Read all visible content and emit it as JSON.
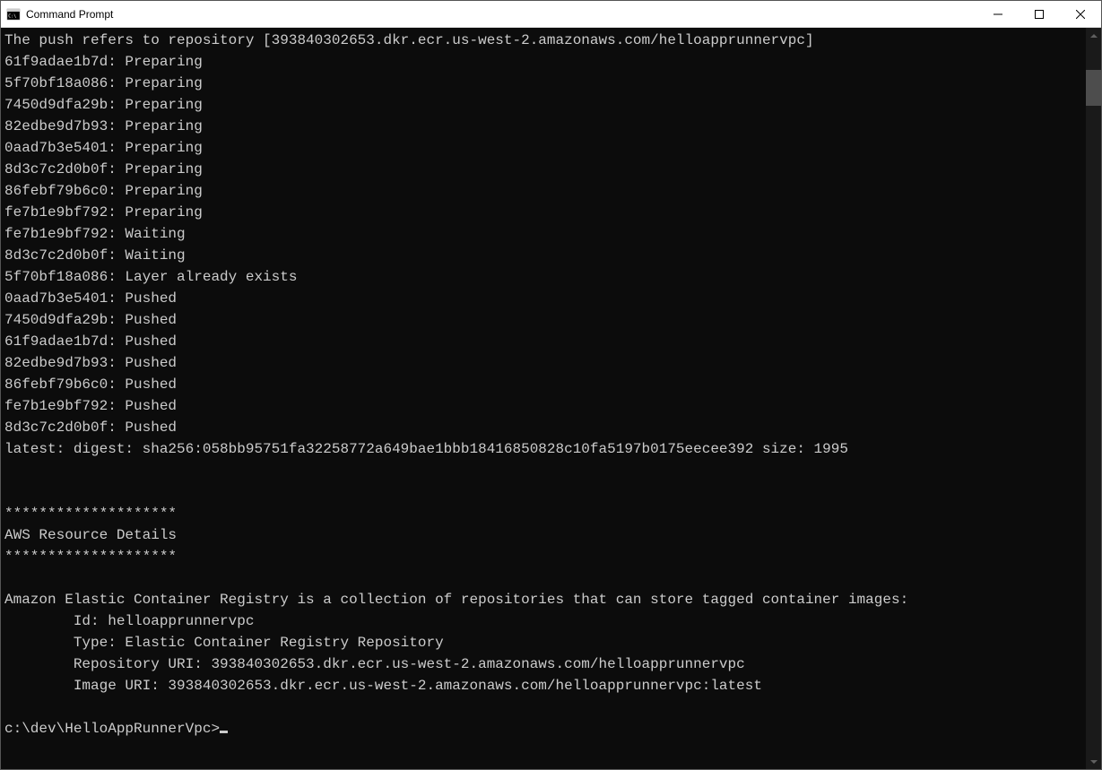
{
  "window": {
    "title": "Command Prompt"
  },
  "terminal": {
    "lines": [
      "The push refers to repository [393840302653.dkr.ecr.us-west-2.amazonaws.com/helloapprunnervpc]",
      "61f9adae1b7d: Preparing",
      "5f70bf18a086: Preparing",
      "7450d9dfa29b: Preparing",
      "82edbe9d7b93: Preparing",
      "0aad7b3e5401: Preparing",
      "8d3c7c2d0b0f: Preparing",
      "86febf79b6c0: Preparing",
      "fe7b1e9bf792: Preparing",
      "fe7b1e9bf792: Waiting",
      "8d3c7c2d0b0f: Waiting",
      "5f70bf18a086: Layer already exists",
      "0aad7b3e5401: Pushed",
      "7450d9dfa29b: Pushed",
      "61f9adae1b7d: Pushed",
      "82edbe9d7b93: Pushed",
      "86febf79b6c0: Pushed",
      "fe7b1e9bf792: Pushed",
      "8d3c7c2d0b0f: Pushed",
      "latest: digest: sha256:058bb95751fa32258772a649bae1bbb18416850828c10fa5197b0175eecee392 size: 1995",
      "",
      "",
      "********************",
      "AWS Resource Details",
      "********************",
      "",
      "Amazon Elastic Container Registry is a collection of repositories that can store tagged container images:",
      "        Id: helloapprunnervpc",
      "        Type: Elastic Container Registry Repository",
      "        Repository URI: 393840302653.dkr.ecr.us-west-2.amazonaws.com/helloapprunnervpc",
      "        Image URI: 393840302653.dkr.ecr.us-west-2.amazonaws.com/helloapprunnervpc:latest",
      ""
    ],
    "prompt": "c:\\dev\\HelloAppRunnerVpc>"
  }
}
